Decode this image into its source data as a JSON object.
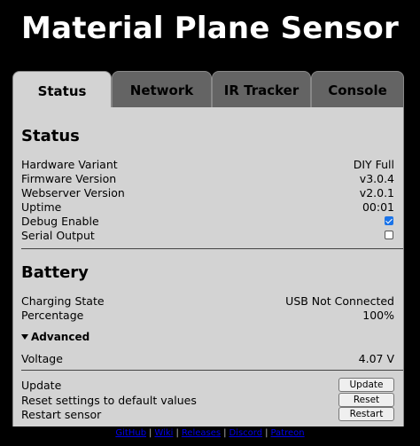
{
  "app": {
    "title": "Material Plane Sensor"
  },
  "tabs": [
    {
      "label": "Status"
    },
    {
      "label": "Network"
    },
    {
      "label": "IR Tracker"
    },
    {
      "label": "Console"
    }
  ],
  "status": {
    "heading": "Status",
    "rows": [
      {
        "label": "Hardware Variant",
        "value": "DIY Full"
      },
      {
        "label": "Firmware Version",
        "value": "v3.0.4"
      },
      {
        "label": "Webserver Version",
        "value": "v2.0.1"
      },
      {
        "label": "Uptime",
        "value": "00:01"
      }
    ],
    "debug_label": "Debug Enable",
    "debug_checked": true,
    "serial_label": "Serial Output",
    "serial_checked": false
  },
  "battery": {
    "heading": "Battery",
    "charging_label": "Charging State",
    "charging_value": "USB Not Connected",
    "percentage_label": "Percentage",
    "percentage_value": "100%",
    "advanced_label": "Advanced",
    "voltage_label": "Voltage",
    "voltage_value": "4.07 V"
  },
  "actions": {
    "update_label": "Update",
    "update_button": "Update",
    "reset_label": "Reset settings to default values",
    "reset_button": "Reset",
    "restart_label": "Restart sensor",
    "restart_button": "Restart"
  },
  "footer": {
    "links": [
      "GitHub",
      "Wiki",
      "Releases",
      "Discord",
      "Patreon"
    ],
    "separator": "|"
  }
}
